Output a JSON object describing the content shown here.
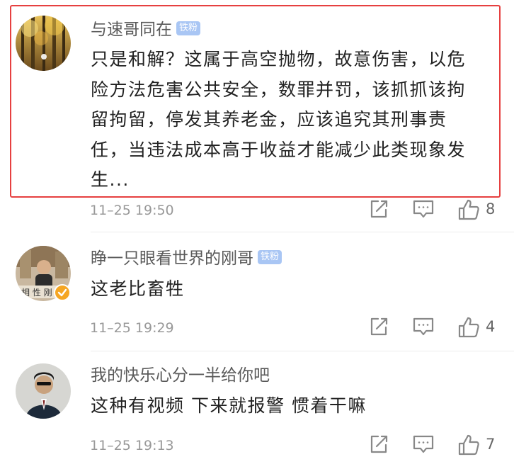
{
  "comments": [
    {
      "username": "与速哥同在",
      "badge": "铁粉",
      "lines": [
        "只是和解？这属于高空抛物，故意伤害，以危",
        "险方法危害公共安全，数罪并罚，该抓抓该拘",
        "留拘留，停发其养老金，应该追究其刑事责",
        "任，当违法成本高于收益才能减少此类现象发",
        "生..."
      ],
      "time": "11–25 19:50",
      "likes": "8"
    },
    {
      "username": "睁一只眼看世界的刚哥",
      "badge": "铁粉",
      "lines": [
        "这老比畜牲"
      ],
      "time": "11–25 19:29",
      "likes": "4"
    },
    {
      "username": "我的快乐心分一半给你吧",
      "badge": "",
      "lines": [
        "这种有视频 下来就报警 惯着干嘛"
      ],
      "time": "11–25 19:13",
      "likes": "7"
    }
  ],
  "colors": {
    "highlight_border": "#e64040",
    "badge_bg": "#a9c6f4",
    "verified_badge": "#f5a623"
  }
}
